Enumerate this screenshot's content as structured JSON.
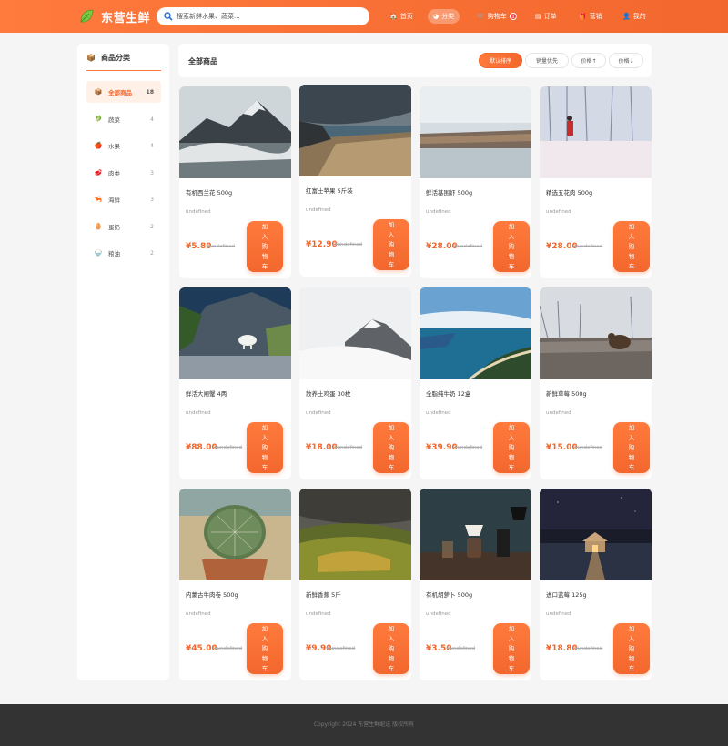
{
  "header": {
    "brand": "东营生鲜",
    "search_placeholder": "搜索新鲜水果、蔬菜...",
    "nav": [
      {
        "icon": "home-icon",
        "label": "首页"
      },
      {
        "icon": "grid-icon",
        "label": "分类"
      },
      {
        "icon": "cart-icon",
        "label": "购物车",
        "badge": "3"
      },
      {
        "icon": "order-icon",
        "label": "订单"
      },
      {
        "icon": "gift-icon",
        "label": "营销"
      },
      {
        "icon": "user-icon",
        "label": "我的"
      }
    ]
  },
  "sidebar": {
    "title": "商品分类",
    "items": [
      {
        "icon": "box-icon",
        "label": "全部商品",
        "count": "18"
      },
      {
        "icon": "vegetable-icon",
        "label": "蔬菜",
        "count": "4"
      },
      {
        "icon": "apple-icon",
        "label": "水果",
        "count": "4"
      },
      {
        "icon": "meat-icon",
        "label": "肉类",
        "count": "3"
      },
      {
        "icon": "seafood-icon",
        "label": "海鲜",
        "count": "3"
      },
      {
        "icon": "egg-icon",
        "label": "蛋奶",
        "count": "2"
      },
      {
        "icon": "oil-icon",
        "label": "粮油",
        "count": "2"
      }
    ]
  },
  "main": {
    "title": "全部商品",
    "sort": [
      "默认排序",
      "销量优先",
      "价格↑",
      "价格↓"
    ],
    "products": [
      {
        "name": "有机西兰花 500g",
        "origin": "undefined",
        "price": "¥5.80",
        "old_price": "¥undefined",
        "add_label": "加入购物车",
        "image": "mountain-fog"
      },
      {
        "name": "红富士苹果 5斤装",
        "origin": "undefined",
        "price": "¥12.90",
        "old_price": "¥undefined",
        "add_label": "加入购物车",
        "image": "beach-storm"
      },
      {
        "name": "鲜活基围虾 500g",
        "origin": "undefined",
        "price": "¥28.00",
        "old_price": "¥undefined",
        "add_label": "加入购物车",
        "image": "rocky-shore"
      },
      {
        "name": "精选五花肉 500g",
        "origin": "undefined",
        "price": "¥28.00",
        "old_price": "¥undefined",
        "add_label": "加入购物车",
        "image": "snow-forest"
      },
      {
        "name": "鲜活大闸蟹 4两",
        "origin": "undefined",
        "price": "¥88.00",
        "old_price": "¥undefined",
        "add_label": "加入购物车",
        "image": "mountain-goat"
      },
      {
        "name": "散养土鸡蛋 30枚",
        "origin": "undefined",
        "price": "¥18.00",
        "old_price": "¥undefined",
        "add_label": "加入购物车",
        "image": "misty-peak"
      },
      {
        "name": "全脂纯牛奶 12盒",
        "origin": "undefined",
        "price": "¥39.90",
        "old_price": "¥undefined",
        "add_label": "加入购物车",
        "image": "coast-bay"
      },
      {
        "name": "新鲜草莓 500g",
        "origin": "undefined",
        "price": "¥15.00",
        "old_price": "¥undefined",
        "add_label": "加入购物车",
        "image": "bear-field"
      },
      {
        "name": "内蒙古牛肉卷 500g",
        "origin": "undefined",
        "price": "¥45.00",
        "old_price": "¥undefined",
        "add_label": "加入购物车",
        "image": "cactus"
      },
      {
        "name": "新鲜香蕉 5斤",
        "origin": "undefined",
        "price": "¥9.90",
        "old_price": "¥undefined",
        "add_label": "加入购物车",
        "image": "green-valley"
      },
      {
        "name": "有机胡萝卜 500g",
        "origin": "undefined",
        "price": "¥3.50",
        "old_price": "¥undefined",
        "add_label": "加入购物车",
        "image": "coffee-brew"
      },
      {
        "name": "进口蓝莓 125g",
        "origin": "undefined",
        "price": "¥18.80",
        "old_price": "¥undefined",
        "add_label": "加入购物车",
        "image": "boathouse-night"
      }
    ]
  },
  "footer": {
    "text": "Copyright 2024 东营生鲜配送 版权所有"
  },
  "colors": {
    "brand": "#f2672d",
    "brand_light": "#ff7a3d",
    "footer_bg": "#333333"
  }
}
